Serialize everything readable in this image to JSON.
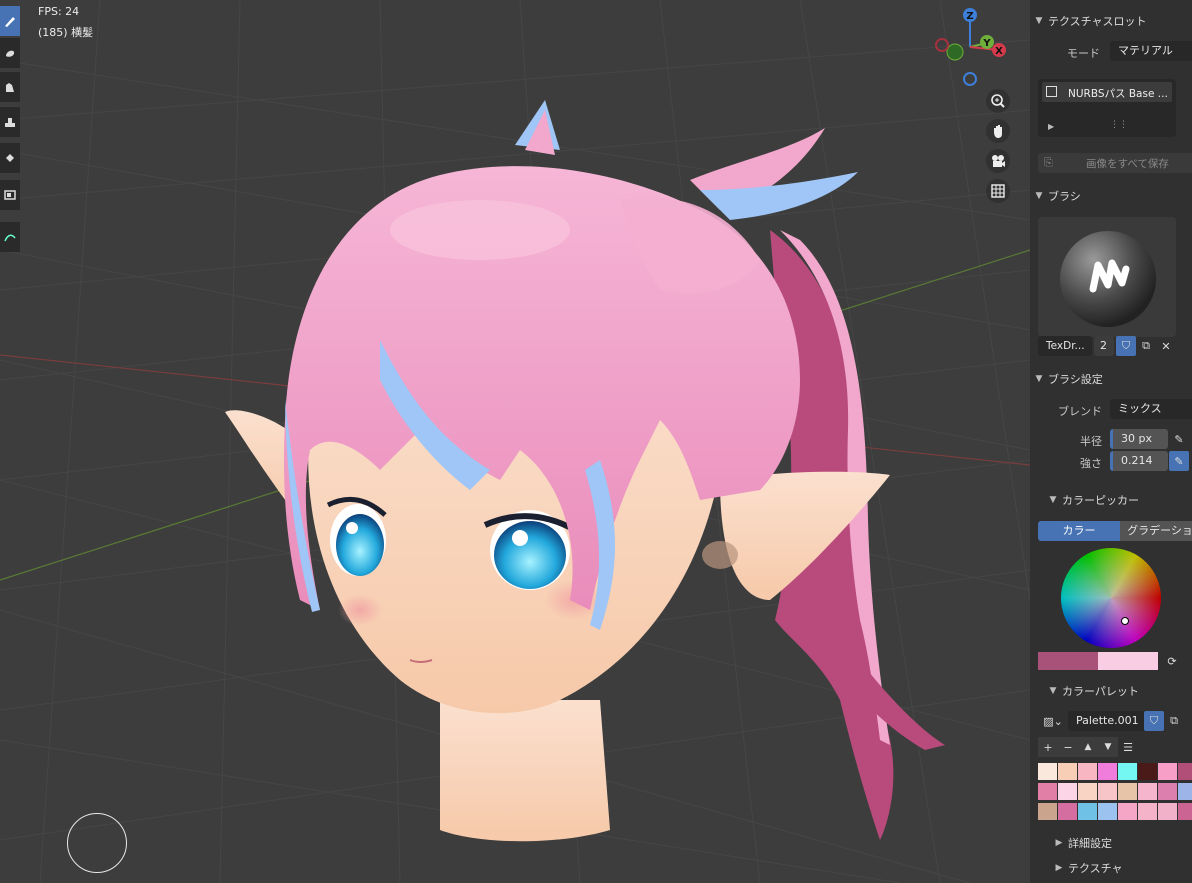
{
  "viewport": {
    "fps": "FPS: 24",
    "object_info": "(185) 横髪",
    "gizmo": {
      "z": "Z",
      "y": "Y",
      "x": "X"
    }
  },
  "toolbar": {
    "tools": [
      "draw-brush-icon",
      "soften-icon",
      "smear-icon",
      "clone-icon",
      "fill-icon",
      "mask-icon",
      "annotate-icon"
    ]
  },
  "nav_buttons": [
    "zoom-icon",
    "pan-hand-icon",
    "camera-icon",
    "grid-icon"
  ],
  "panel": {
    "texture_slots": {
      "title": "テクスチャスロット",
      "mode_label": "モード",
      "mode_value": "マテリアル",
      "slot_item": "NURBSパス Base ...",
      "save_all": "画像をすべて保存"
    },
    "brush": {
      "title": "ブラシ",
      "brush_name": "TexDr...",
      "users": "2"
    },
    "brush_settings": {
      "title": "ブラシ設定",
      "blend_label": "ブレンド",
      "blend_value": "ミックス",
      "radius_label": "半径",
      "radius_value": "30 px",
      "strength_label": "強さ",
      "strength_value": "0.214"
    },
    "color_picker": {
      "title": "カラーピッカー",
      "tab_color": "カラー",
      "tab_gradient": "グラデーショ",
      "primary_color": "#a8527a",
      "secondary_color": "#f9cde3"
    },
    "palette": {
      "title": "カラーパレット",
      "name": "Palette.001",
      "swatches": [
        [
          "#fbe8dc",
          "#f8cfb6",
          "#f7b6c2",
          "#f07ddc",
          "#74f6f2",
          "#4a1a19",
          "#f79fc6",
          "#b14f78"
        ],
        [
          "#e17fa6",
          "#fcd6e6",
          "#f9d3c4",
          "#f7c5c7",
          "#e7c3a8",
          "#f5b6cd",
          "#dd7fae",
          "#9cb4e8"
        ],
        [
          "#caa48c",
          "#d46ea0",
          "#6fc2e6",
          "#9cc2f0",
          "#f5a5c6",
          "#f4b3c9",
          "#f1b1c8",
          "#cb6493"
        ]
      ]
    },
    "collapsed": {
      "advanced": "詳細設定",
      "texture": "テクスチャ"
    }
  }
}
